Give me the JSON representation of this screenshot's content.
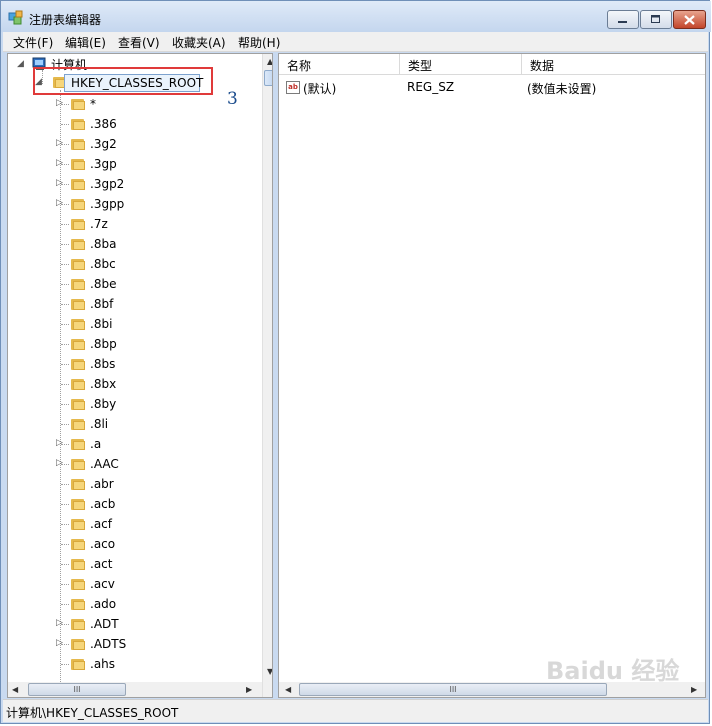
{
  "window": {
    "title": "注册表编辑器"
  },
  "menu": [
    "文件(F)",
    "编辑(E)",
    "查看(V)",
    "收藏夹(A)",
    "帮助(H)"
  ],
  "tree": {
    "root": "计算机",
    "selected": "HKEY_CLASSES_ROOT",
    "annotation": "3",
    "children": [
      {
        "label": "*",
        "expandable": true
      },
      {
        "label": ".386",
        "expandable": false
      },
      {
        "label": ".3g2",
        "expandable": true
      },
      {
        "label": ".3gp",
        "expandable": true
      },
      {
        "label": ".3gp2",
        "expandable": true
      },
      {
        "label": ".3gpp",
        "expandable": true
      },
      {
        "label": ".7z",
        "expandable": false
      },
      {
        "label": ".8ba",
        "expandable": false
      },
      {
        "label": ".8bc",
        "expandable": false
      },
      {
        "label": ".8be",
        "expandable": false
      },
      {
        "label": ".8bf",
        "expandable": false
      },
      {
        "label": ".8bi",
        "expandable": false
      },
      {
        "label": ".8bp",
        "expandable": false
      },
      {
        "label": ".8bs",
        "expandable": false
      },
      {
        "label": ".8bx",
        "expandable": false
      },
      {
        "label": ".8by",
        "expandable": false
      },
      {
        "label": ".8li",
        "expandable": false
      },
      {
        "label": ".a",
        "expandable": true
      },
      {
        "label": ".AAC",
        "expandable": true
      },
      {
        "label": ".abr",
        "expandable": false
      },
      {
        "label": ".acb",
        "expandable": false
      },
      {
        "label": ".acf",
        "expandable": false
      },
      {
        "label": ".aco",
        "expandable": false
      },
      {
        "label": ".act",
        "expandable": false
      },
      {
        "label": ".acv",
        "expandable": false
      },
      {
        "label": ".ado",
        "expandable": false
      },
      {
        "label": ".ADT",
        "expandable": true
      },
      {
        "label": ".ADTS",
        "expandable": true
      },
      {
        "label": ".ahs",
        "expandable": false
      }
    ]
  },
  "list": {
    "columns": [
      "名称",
      "类型",
      "数据"
    ],
    "rows": [
      {
        "name": "(默认)",
        "type": "REG_SZ",
        "data": "(数值未设置)"
      }
    ]
  },
  "scroll": {
    "thumb_grip": "III"
  },
  "status": {
    "path": "计算机\\HKEY_CLASSES_ROOT"
  },
  "watermark": "Baidu 经验",
  "colors": {
    "highlight": "#e03a3a",
    "annotation": "#1a4b8c",
    "folder": "#f6d67b"
  }
}
